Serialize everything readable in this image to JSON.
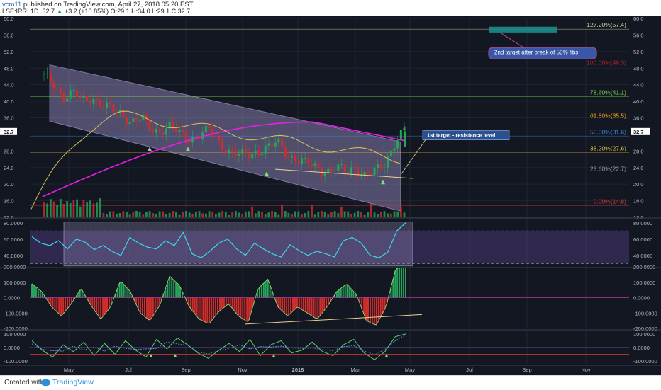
{
  "header": {
    "user": "vcm11",
    "published": "published on TradingView.com, April 27, 2018 05:20 EST",
    "symbol": "LSE:IRR, 1D",
    "last": "32.7",
    "change": "+3.2 (+10.85%)",
    "ohlc": "O:29.1 H:34.0 L:29.1 C:32.7"
  },
  "footer": {
    "created": "Created with",
    "brand": "TradingView"
  },
  "colors": {
    "background": "#131722",
    "channel": "#9c8fc9",
    "ma": "#e81ee8",
    "rsi": "#3fd7f0",
    "up": "#26a65b",
    "down": "#d12d2d",
    "target_box": "#1d8a8a",
    "callout": "#3a56a6"
  },
  "chart_data": [
    {
      "type": "line",
      "panel": "price",
      "ylim": [
        12,
        60
      ],
      "yticks": [
        "60.0",
        "56.0",
        "52.0",
        "48.0",
        "44.0",
        "40.0",
        "36.0",
        "32.7",
        "28.0",
        "24.0",
        "20.0",
        "16.0",
        "12.0"
      ],
      "x_tick_labels": [
        "May",
        "Jul",
        "Sep",
        "Nov",
        "2018",
        "Mar",
        "May",
        "Jul",
        "Sep",
        "Nov"
      ],
      "last_price": 32.7,
      "fib_levels": [
        {
          "label": "127.20%(57.4)",
          "value": 57.4,
          "color": "#d9d9a0"
        },
        {
          "label": "100.00%(48.3)",
          "value": 48.3,
          "color": "#b0242b"
        },
        {
          "label": "78.60%(41.1)",
          "value": 41.1,
          "color": "#7ddc4a"
        },
        {
          "label": "61.80%(35.5)",
          "value": 35.5,
          "color": "#f0a020"
        },
        {
          "label": "50.00%(31.6)",
          "value": 31.6,
          "color": "#3d8de0"
        },
        {
          "label": "38.20%(27.6)",
          "value": 27.6,
          "color": "#e8c43a"
        },
        {
          "label": "23.60%(22.7)",
          "value": 22.7,
          "color": "#9aa0a6"
        },
        {
          "label": "0.00%(14.8)",
          "value": 14.8,
          "color": "#d43a3a"
        }
      ],
      "price_series": [
        46,
        44,
        41,
        42,
        40,
        41,
        39,
        38,
        37,
        35,
        36,
        33,
        33,
        34,
        32,
        31,
        32,
        33,
        30,
        28,
        27,
        27,
        28,
        29,
        30,
        27,
        26,
        25,
        24,
        23,
        24,
        23,
        24,
        22,
        23,
        25,
        30,
        33
      ],
      "annotations": [
        {
          "text": "1st target - resistance level"
        },
        {
          "text": "2nd target after break of 50% fibs"
        }
      ]
    },
    {
      "type": "line",
      "panel": "rsi",
      "ylim": [
        25,
        85
      ],
      "yticks": [
        "80.0000",
        "60.0000",
        "40.0000"
      ],
      "values": [
        63,
        55,
        52,
        58,
        48,
        60,
        56,
        47,
        52,
        45,
        40,
        62,
        55,
        50,
        48,
        58,
        52,
        68,
        42,
        37,
        45,
        55,
        60,
        48,
        40,
        55,
        48,
        42,
        38,
        53,
        46,
        40,
        45,
        42,
        38,
        58,
        62,
        55,
        40,
        37,
        44,
        70,
        80
      ]
    },
    {
      "type": "area",
      "panel": "cci",
      "ylim": [
        -200,
        200
      ],
      "yticks": [
        "200.0000",
        "100.0000",
        "0.0000",
        "-100.0000",
        "-200.0000"
      ],
      "values": [
        90,
        40,
        -60,
        -120,
        -40,
        60,
        -50,
        -140,
        -60,
        110,
        40,
        -100,
        -150,
        -50,
        140,
        80,
        -60,
        -140,
        -170,
        -90,
        -40,
        -120,
        -160,
        60,
        120,
        -60,
        -120,
        -60,
        -100,
        -140,
        -60,
        40,
        90,
        20,
        -150,
        -180,
        -60,
        190,
        195
      ]
    },
    {
      "type": "line",
      "panel": "momentum",
      "ylim": [
        -120,
        120
      ],
      "yticks": [
        "100.0000",
        "0.0000",
        "-100.0000"
      ],
      "values": [
        50,
        -20,
        -70,
        20,
        -30,
        40,
        -60,
        30,
        -50,
        50,
        -20,
        -70,
        60,
        -10,
        70,
        20,
        -40,
        -80,
        -20,
        30,
        -30,
        60,
        -60,
        20,
        50,
        -40,
        -20,
        40,
        -30,
        -60,
        20,
        60,
        -40,
        -90,
        -30,
        80,
        100
      ]
    }
  ]
}
